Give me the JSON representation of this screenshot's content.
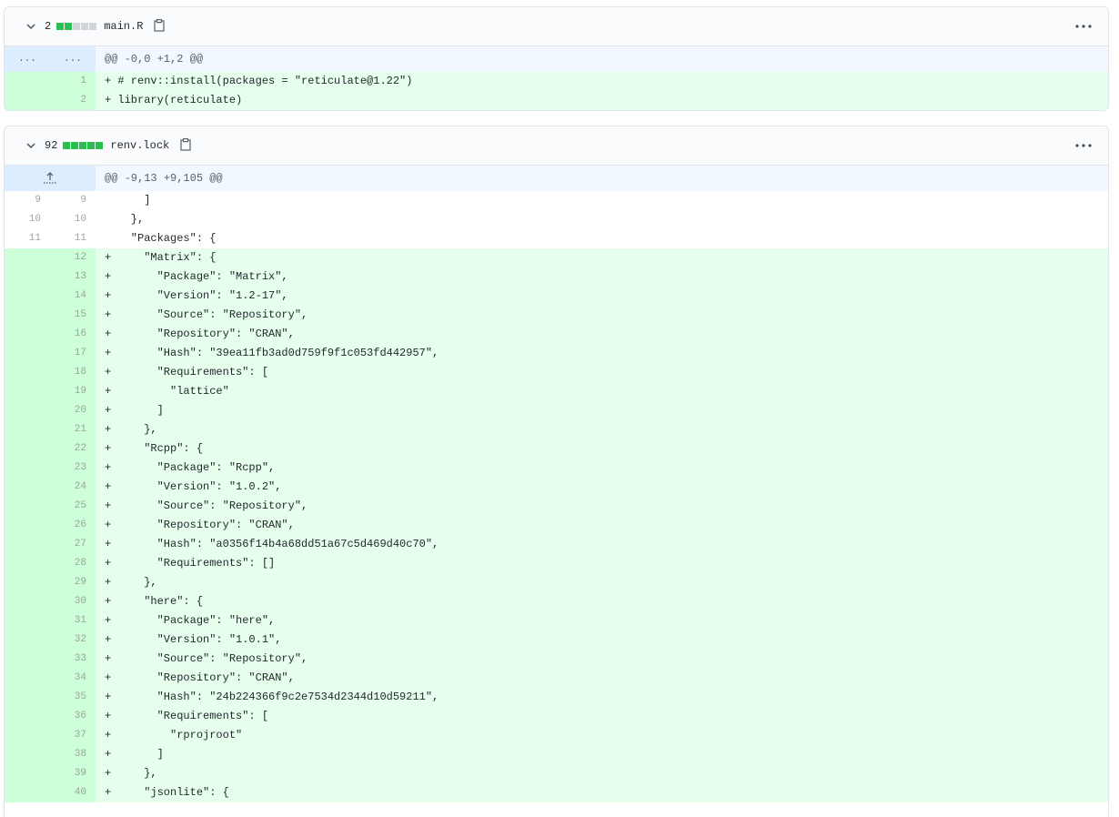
{
  "files": [
    {
      "count": "2",
      "filename": "main.R",
      "diffstat": [
        "g",
        "g",
        "n",
        "n",
        "n"
      ],
      "hunk": {
        "left": "...",
        "right": "...",
        "header": "@@ -0,0 +1,2 @@"
      },
      "lines": [
        {
          "type": "add",
          "old": "",
          "new": "1",
          "text": "+ # renv::install(packages = \"reticulate@1.22\")"
        },
        {
          "type": "add",
          "old": "",
          "new": "2",
          "text": "+ library(reticulate)"
        }
      ]
    },
    {
      "count": "92",
      "filename": "renv.lock",
      "diffstat": [
        "g",
        "g",
        "g",
        "g",
        "g"
      ],
      "hunk": {
        "header": "@@ -9,13 +9,105 @@"
      },
      "lines": [
        {
          "type": "ctx",
          "old": "9",
          "new": "9",
          "text": "      ]"
        },
        {
          "type": "ctx",
          "old": "10",
          "new": "10",
          "text": "    },"
        },
        {
          "type": "ctx",
          "old": "11",
          "new": "11",
          "text": "    \"Packages\": {"
        },
        {
          "type": "add",
          "old": "",
          "new": "12",
          "text": "+     \"Matrix\": {"
        },
        {
          "type": "add",
          "old": "",
          "new": "13",
          "text": "+       \"Package\": \"Matrix\","
        },
        {
          "type": "add",
          "old": "",
          "new": "14",
          "text": "+       \"Version\": \"1.2-17\","
        },
        {
          "type": "add",
          "old": "",
          "new": "15",
          "text": "+       \"Source\": \"Repository\","
        },
        {
          "type": "add",
          "old": "",
          "new": "16",
          "text": "+       \"Repository\": \"CRAN\","
        },
        {
          "type": "add",
          "old": "",
          "new": "17",
          "text": "+       \"Hash\": \"39ea11fb3ad0d759f9f1c053fd442957\","
        },
        {
          "type": "add",
          "old": "",
          "new": "18",
          "text": "+       \"Requirements\": ["
        },
        {
          "type": "add",
          "old": "",
          "new": "19",
          "text": "+         \"lattice\""
        },
        {
          "type": "add",
          "old": "",
          "new": "20",
          "text": "+       ]"
        },
        {
          "type": "add",
          "old": "",
          "new": "21",
          "text": "+     },"
        },
        {
          "type": "add",
          "old": "",
          "new": "22",
          "text": "+     \"Rcpp\": {"
        },
        {
          "type": "add",
          "old": "",
          "new": "23",
          "text": "+       \"Package\": \"Rcpp\","
        },
        {
          "type": "add",
          "old": "",
          "new": "24",
          "text": "+       \"Version\": \"1.0.2\","
        },
        {
          "type": "add",
          "old": "",
          "new": "25",
          "text": "+       \"Source\": \"Repository\","
        },
        {
          "type": "add",
          "old": "",
          "new": "26",
          "text": "+       \"Repository\": \"CRAN\","
        },
        {
          "type": "add",
          "old": "",
          "new": "27",
          "text": "+       \"Hash\": \"a0356f14b4a68dd51a67c5d469d40c70\","
        },
        {
          "type": "add",
          "old": "",
          "new": "28",
          "text": "+       \"Requirements\": []"
        },
        {
          "type": "add",
          "old": "",
          "new": "29",
          "text": "+     },"
        },
        {
          "type": "add",
          "old": "",
          "new": "30",
          "text": "+     \"here\": {"
        },
        {
          "type": "add",
          "old": "",
          "new": "31",
          "text": "+       \"Package\": \"here\","
        },
        {
          "type": "add",
          "old": "",
          "new": "32",
          "text": "+       \"Version\": \"1.0.1\","
        },
        {
          "type": "add",
          "old": "",
          "new": "33",
          "text": "+       \"Source\": \"Repository\","
        },
        {
          "type": "add",
          "old": "",
          "new": "34",
          "text": "+       \"Repository\": \"CRAN\","
        },
        {
          "type": "add",
          "old": "",
          "new": "35",
          "text": "+       \"Hash\": \"24b224366f9c2e7534d2344d10d59211\","
        },
        {
          "type": "add",
          "old": "",
          "new": "36",
          "text": "+       \"Requirements\": ["
        },
        {
          "type": "add",
          "old": "",
          "new": "37",
          "text": "+         \"rprojroot\""
        },
        {
          "type": "add",
          "old": "",
          "new": "38",
          "text": "+       ]"
        },
        {
          "type": "add",
          "old": "",
          "new": "39",
          "text": "+     },"
        },
        {
          "type": "add",
          "old": "",
          "new": "40",
          "text": "+     \"jsonlite\": {"
        }
      ]
    }
  ],
  "colors": {
    "added": "#2cbe4e",
    "neutral": "#d1d5da"
  }
}
